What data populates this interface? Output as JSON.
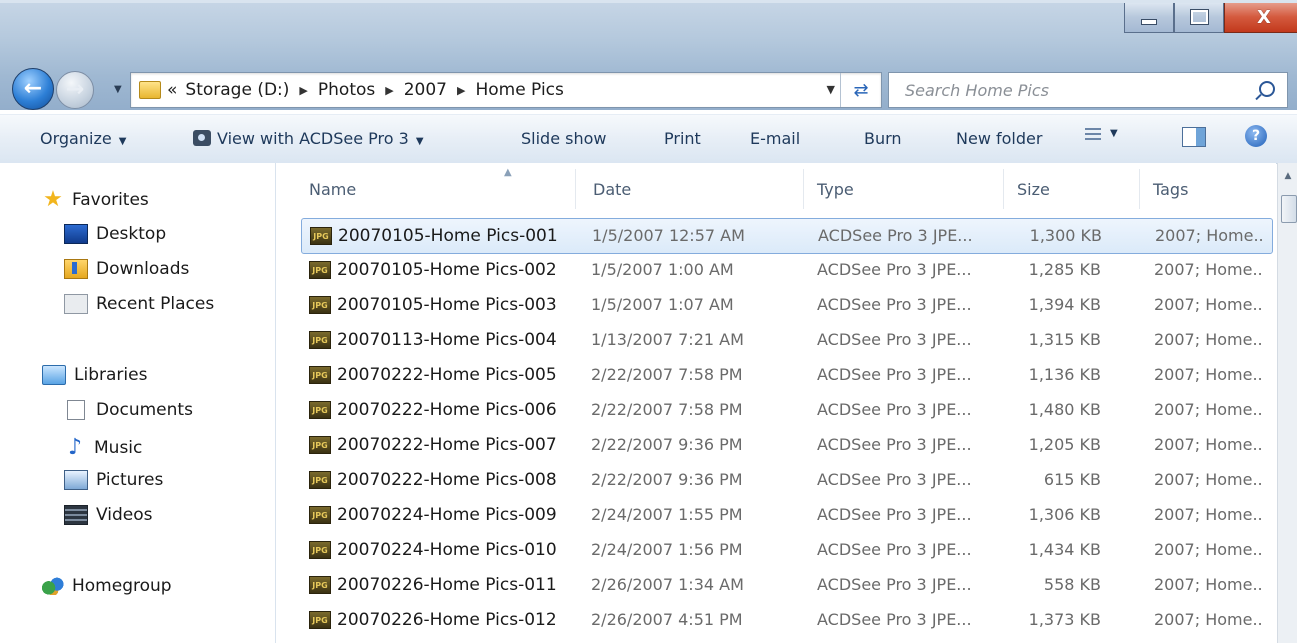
{
  "window": {
    "controls": {
      "minimize": "–",
      "maximize": "□",
      "close": "X"
    }
  },
  "nav": {
    "back_icon": "back-arrow-icon",
    "forward_icon": "forward-arrow-icon",
    "breadcrumb_prefix": "«",
    "breadcrumb": [
      "Storage (D:)",
      "Photos",
      "2007",
      "Home Pics"
    ],
    "search_placeholder": "Search Home Pics"
  },
  "toolbar": {
    "organize": "Organize",
    "view_with": "View with ACDSee Pro 3",
    "slide_show": "Slide show",
    "print": "Print",
    "email": "E-mail",
    "burn": "Burn",
    "new_folder": "New folder"
  },
  "sidebar": {
    "favorites": {
      "label": "Favorites",
      "items": [
        "Desktop",
        "Downloads",
        "Recent Places"
      ]
    },
    "libraries": {
      "label": "Libraries",
      "items": [
        "Documents",
        "Music",
        "Pictures",
        "Videos"
      ]
    },
    "homegroup": "Homegroup"
  },
  "columns": {
    "name": "Name",
    "date": "Date",
    "type": "Type",
    "size": "Size",
    "tags": "Tags"
  },
  "files": [
    {
      "name": "20070105-Home Pics-001",
      "date": "1/5/2007 12:57 AM",
      "type": "ACDSee Pro 3 JPE...",
      "size": "1,300 KB",
      "tags": "2007; Home..",
      "selected": true
    },
    {
      "name": "20070105-Home Pics-002",
      "date": "1/5/2007 1:00 AM",
      "type": "ACDSee Pro 3 JPE...",
      "size": "1,285 KB",
      "tags": "2007; Home.."
    },
    {
      "name": "20070105-Home Pics-003",
      "date": "1/5/2007 1:07 AM",
      "type": "ACDSee Pro 3 JPE...",
      "size": "1,394 KB",
      "tags": "2007; Home.."
    },
    {
      "name": "20070113-Home Pics-004",
      "date": "1/13/2007 7:21 AM",
      "type": "ACDSee Pro 3 JPE...",
      "size": "1,315 KB",
      "tags": "2007; Home.."
    },
    {
      "name": "20070222-Home Pics-005",
      "date": "2/22/2007 7:58 PM",
      "type": "ACDSee Pro 3 JPE...",
      "size": "1,136 KB",
      "tags": "2007; Home.."
    },
    {
      "name": "20070222-Home Pics-006",
      "date": "2/22/2007 7:58 PM",
      "type": "ACDSee Pro 3 JPE...",
      "size": "1,480 KB",
      "tags": "2007; Home.."
    },
    {
      "name": "20070222-Home Pics-007",
      "date": "2/22/2007 9:36 PM",
      "type": "ACDSee Pro 3 JPE...",
      "size": "1,205 KB",
      "tags": "2007; Home.."
    },
    {
      "name": "20070222-Home Pics-008",
      "date": "2/22/2007 9:36 PM",
      "type": "ACDSee Pro 3 JPE...",
      "size": "615 KB",
      "tags": "2007; Home.."
    },
    {
      "name": "20070224-Home Pics-009",
      "date": "2/24/2007 1:55 PM",
      "type": "ACDSee Pro 3 JPE...",
      "size": "1,306 KB",
      "tags": "2007; Home.."
    },
    {
      "name": "20070224-Home Pics-010",
      "date": "2/24/2007 1:56 PM",
      "type": "ACDSee Pro 3 JPE...",
      "size": "1,434 KB",
      "tags": "2007; Home.."
    },
    {
      "name": "20070226-Home Pics-011",
      "date": "2/26/2007 1:34 AM",
      "type": "ACDSee Pro 3 JPE...",
      "size": "558 KB",
      "tags": "2007; Home.."
    },
    {
      "name": "20070226-Home Pics-012",
      "date": "2/26/2007 4:51 PM",
      "type": "ACDSee Pro 3 JPE...",
      "size": "1,373 KB",
      "tags": "2007; Home.."
    }
  ],
  "colors": {
    "selection_border": "#84acdd",
    "accent": "#1e395b"
  }
}
